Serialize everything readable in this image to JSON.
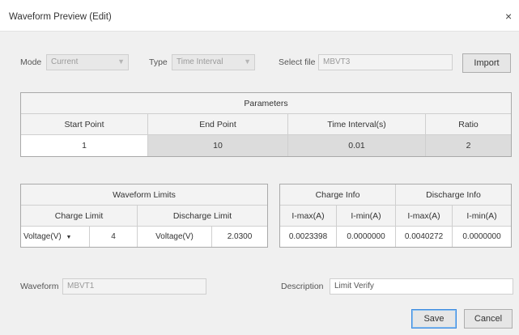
{
  "window": {
    "title": "Waveform Preview (Edit)",
    "close_glyph": "×"
  },
  "mode": {
    "label": "Mode",
    "value": "Current"
  },
  "type": {
    "label": "Type",
    "value": "Time Interval"
  },
  "select_file": {
    "label": "Select file",
    "value": "MBVT3",
    "import_label": "Import"
  },
  "parameters": {
    "title": "Parameters",
    "columns": [
      "Start Point",
      "End Point",
      "Time Interval(s)",
      "Ratio"
    ],
    "row": [
      "1",
      "10",
      "0.01",
      "2"
    ]
  },
  "waveform_limits": {
    "title": "Waveform Limits",
    "columns": [
      "Charge Limit",
      "Discharge Limit"
    ],
    "row": {
      "charge_type": "Voltage(V)",
      "charge_value": "4",
      "discharge_type": "Voltage(V)",
      "discharge_value": "2.0300"
    }
  },
  "charge_info": {
    "title": "Charge Info",
    "columns": [
      "I-max(A)",
      "I-min(A)"
    ],
    "row": [
      "0.0023398",
      "0.0000000"
    ]
  },
  "discharge_info": {
    "title": "Discharge Info",
    "columns": [
      "I-max(A)",
      "I-min(A)"
    ],
    "row": [
      "0.0040272",
      "0.0000000"
    ]
  },
  "waveform": {
    "label": "Waveform",
    "value": "MBVT1"
  },
  "description": {
    "label": "Description",
    "value": "Limit Verify"
  },
  "buttons": {
    "save": "Save",
    "cancel": "Cancel"
  },
  "icons": {
    "dropdown": "chevron-down-icon"
  },
  "colors": {
    "primary_button_border": "#3c8be0",
    "window_bg": "#f0f0f0"
  }
}
